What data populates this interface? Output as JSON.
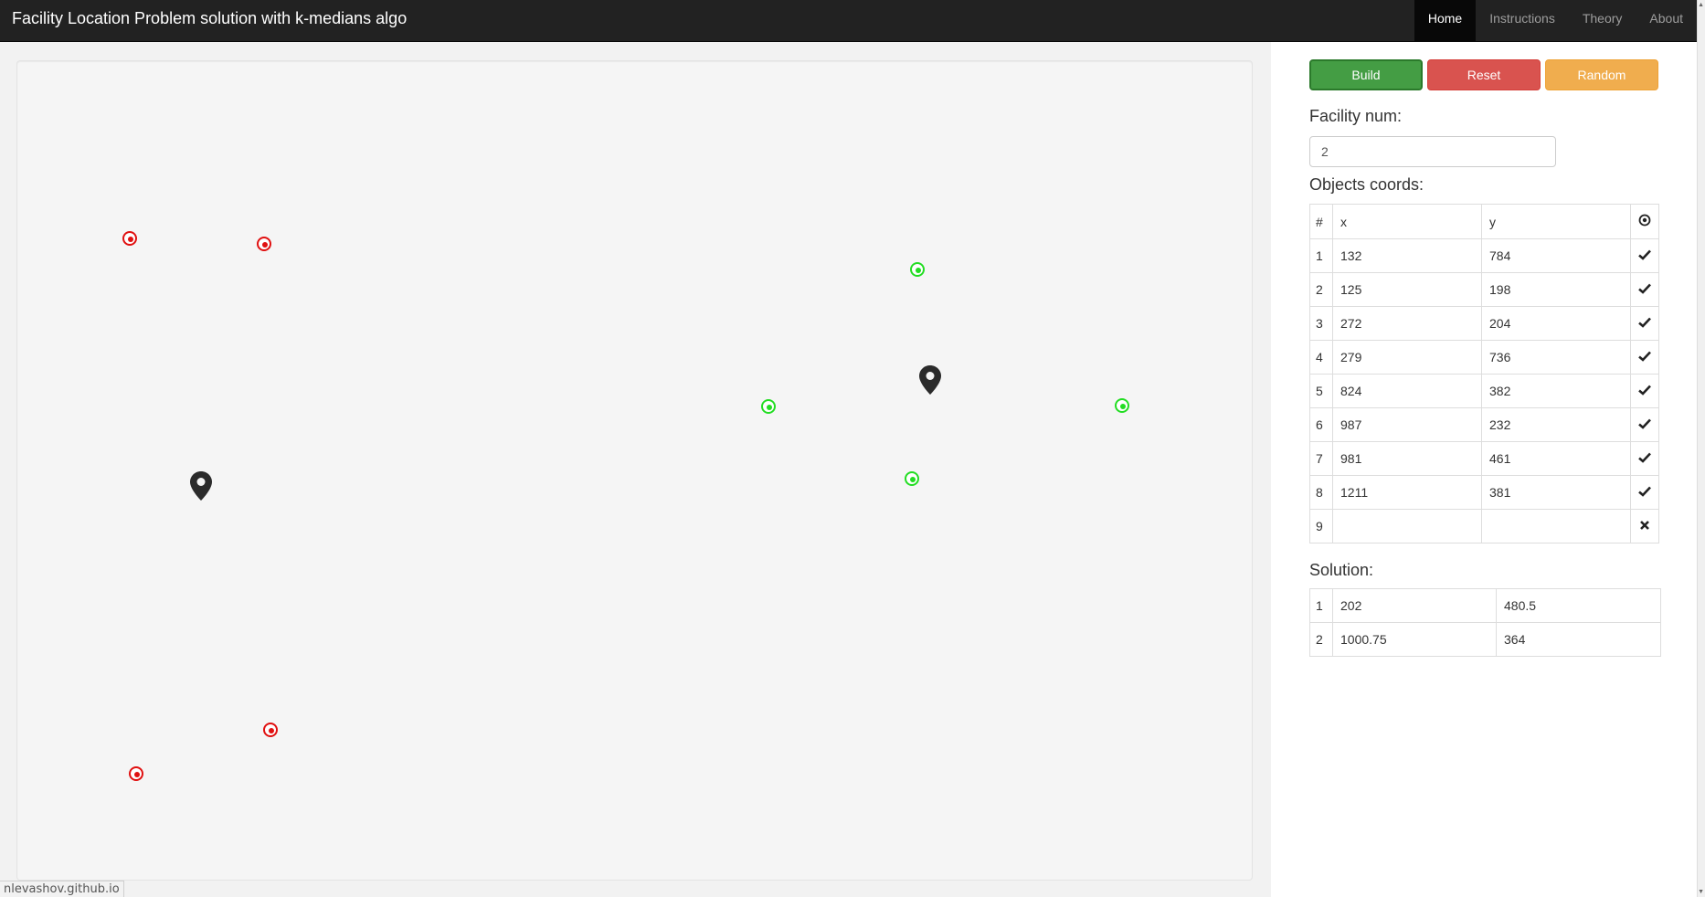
{
  "navbar": {
    "brand": "Facility Location Problem solution with k-medians algo",
    "items": [
      "Home",
      "Instructions",
      "Theory",
      "About"
    ],
    "active": "Home"
  },
  "canvas": {
    "objects_red": 4,
    "objects_green": 4,
    "facilities": 2
  },
  "status_url": "nlevashov.github.io",
  "controls": {
    "build_label": "Build",
    "reset_label": "Reset",
    "random_label": "Random",
    "facility_num_label": "Facility num:",
    "facility_num_value": "2",
    "objects_label": "Objects coords:",
    "solution_label": "Solution:"
  },
  "objects_table": {
    "headers": [
      "#",
      "x",
      "y"
    ],
    "rows": [
      {
        "num": "1",
        "x": "132",
        "y": "784",
        "status": "check"
      },
      {
        "num": "2",
        "x": "125",
        "y": "198",
        "status": "check"
      },
      {
        "num": "3",
        "x": "272",
        "y": "204",
        "status": "check"
      },
      {
        "num": "4",
        "x": "279",
        "y": "736",
        "status": "check"
      },
      {
        "num": "5",
        "x": "824",
        "y": "382",
        "status": "check"
      },
      {
        "num": "6",
        "x": "987",
        "y": "232",
        "status": "check"
      },
      {
        "num": "7",
        "x": "981",
        "y": "461",
        "status": "check"
      },
      {
        "num": "8",
        "x": "1211",
        "y": "381",
        "status": "check"
      },
      {
        "num": "9",
        "x": "",
        "y": "",
        "status": "remove"
      }
    ]
  },
  "solution_table": {
    "rows": [
      {
        "num": "1",
        "x": "202",
        "y": "480.5"
      },
      {
        "num": "2",
        "x": "1000.75",
        "y": "364"
      }
    ]
  },
  "colors": {
    "navbar": "#222222",
    "object_cluster_1": "#e01010",
    "object_cluster_2": "#22dd22",
    "build": "#449d44",
    "reset": "#d9534f",
    "random": "#f0ad4e"
  }
}
